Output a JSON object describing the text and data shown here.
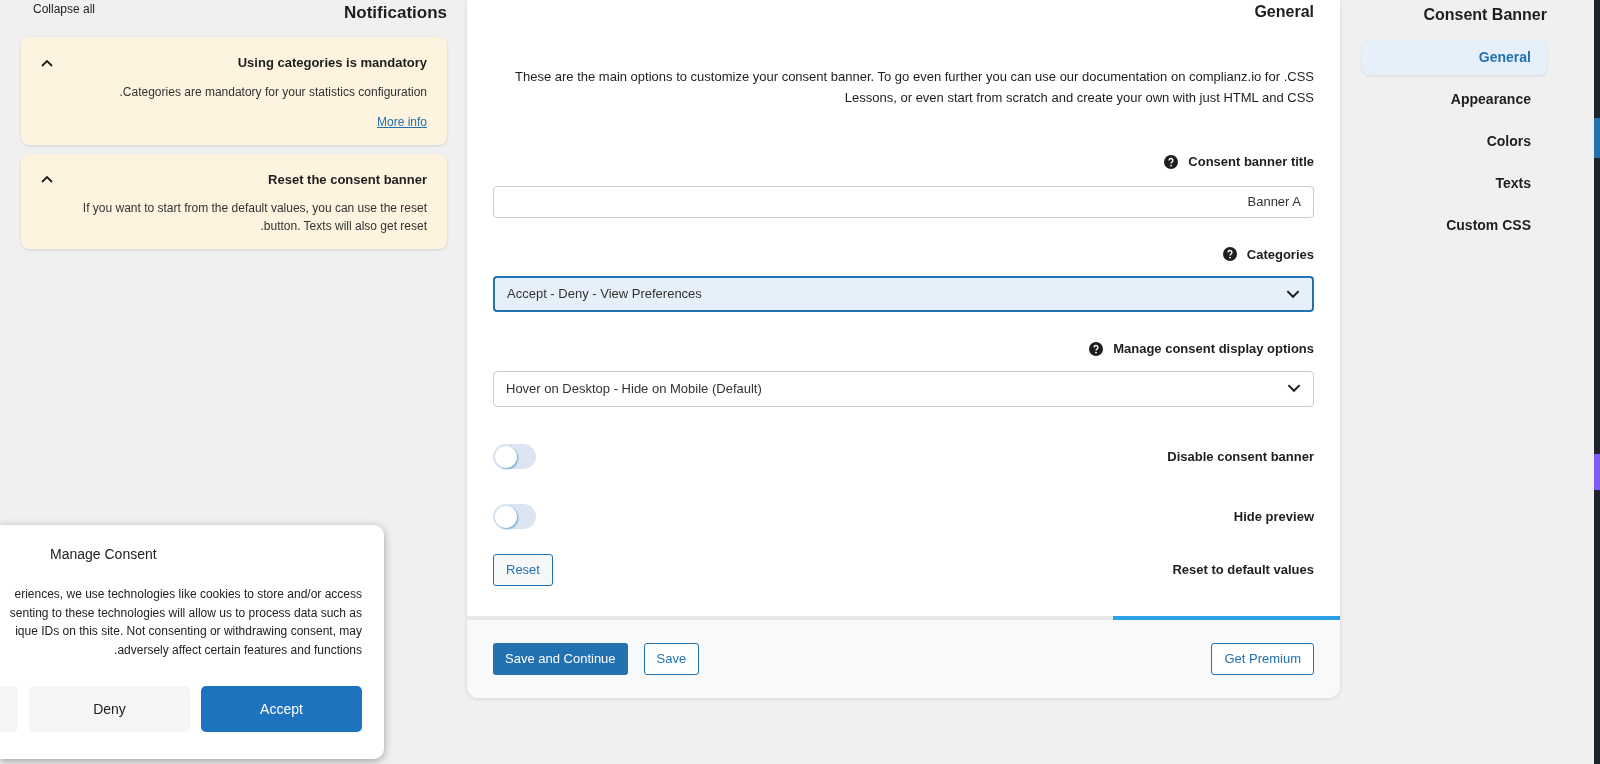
{
  "left_header": {
    "collapse_link": "Collapse all",
    "title": "Notifications"
  },
  "notifications": [
    {
      "title": "Using categories is mandatory",
      "text": ".Categories are mandatory for your statistics configuration",
      "link": "More info",
      "expanded": true
    },
    {
      "title": "Reset the consent banner",
      "text": "If you want to start from the default values, you can use the reset .button. Texts will also get reset",
      "expanded": true
    }
  ],
  "main": {
    "title": "General",
    "intro": "These are the main options to customize your consent banner. To go even further you can use our documentation on complianz.io for .CSS Lessons, or even start from scratch and create your own with just HTML and CSS",
    "fields": [
      {
        "kind": "text",
        "label": "Consent banner title",
        "help": true,
        "value": "Banner A"
      },
      {
        "kind": "select",
        "label": "Categories",
        "help": true,
        "value": "Accept - Deny - View Preferences",
        "focused": true
      },
      {
        "kind": "select",
        "label": "Manage consent display options",
        "help": true,
        "value": "Hover on Desktop - Hide on Mobile (Default)",
        "focused": false
      },
      {
        "kind": "toggle",
        "label": "Disable consent banner",
        "on": false
      },
      {
        "kind": "toggle",
        "label": "Hide preview",
        "on": false
      },
      {
        "kind": "button",
        "label": "Reset to default values",
        "button": "Reset"
      }
    ],
    "progress": {
      "level": 0.26
    },
    "footer": {
      "primary": "Save and Continue",
      "secondary": "Save",
      "premium": "Get Premium"
    }
  },
  "nav": {
    "title": "Consent Banner",
    "items": [
      {
        "label": "General",
        "selected": true
      },
      {
        "label": "Appearance",
        "selected": false
      },
      {
        "label": "Colors",
        "selected": false
      },
      {
        "label": "Texts",
        "selected": false
      },
      {
        "label": "Custom CSS",
        "selected": false
      }
    ]
  },
  "consent_popup": {
    "title": "Manage Consent",
    "body_lines": [
      "eriences, we use technologies like cookies to store and/or access",
      "senting to these technologies will allow us to process data such as",
      "ique IDs on this site. Not consenting or withdrawing consent, may",
      ".adversely affect certain features and functions"
    ],
    "deny": "Deny",
    "accept": "Accept"
  }
}
